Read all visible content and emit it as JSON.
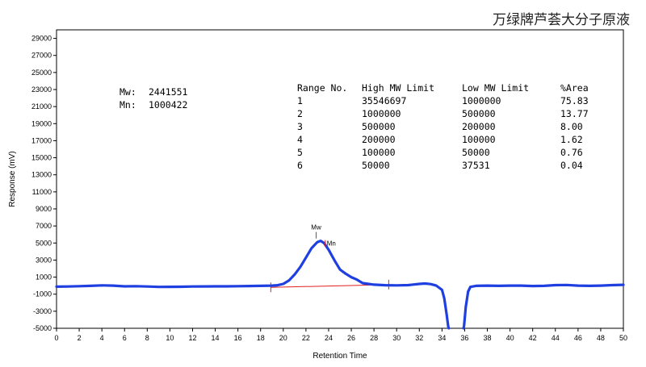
{
  "sample_title": "万绿牌芦荟大分子原液",
  "chart_data": {
    "type": "line",
    "title": "万绿牌芦荟大分子原液",
    "xlabel": "Retention Time",
    "ylabel": "Response (mV)",
    "xlim": [
      0,
      50
    ],
    "ylim": [
      -5000,
      30000
    ],
    "x_ticks": [
      0,
      2,
      4,
      6,
      8,
      10,
      12,
      14,
      16,
      18,
      20,
      22,
      24,
      26,
      28,
      30,
      32,
      34,
      36,
      38,
      40,
      42,
      44,
      46,
      48,
      50
    ],
    "y_ticks": [
      -5000,
      -3000,
      -1000,
      1000,
      3000,
      5000,
      7000,
      9000,
      11000,
      13000,
      15000,
      17000,
      19000,
      21000,
      23000,
      25000,
      27000,
      29000
    ],
    "grid": false,
    "series": [
      {
        "color": "#1f3fe0",
        "x": [
          0,
          1,
          2,
          3,
          4,
          5,
          6,
          7,
          8,
          9,
          10,
          11,
          12,
          13,
          14,
          15,
          16,
          17,
          18,
          19,
          19.5,
          20,
          20.5,
          21,
          21.5,
          22,
          22.5,
          23,
          23.3,
          23.6,
          24,
          24.5,
          25,
          25.5,
          26,
          26.5,
          27,
          28,
          29,
          30,
          31,
          32,
          32.5,
          33,
          33.5,
          34,
          34.2,
          34.4,
          34.55,
          34.6,
          35.9,
          35.95,
          36.1,
          36.3,
          36.5,
          37,
          38,
          39,
          40,
          41,
          42,
          43,
          44,
          45,
          46,
          47,
          48,
          49,
          50
        ],
        "y": [
          -120,
          -100,
          -60,
          -20,
          30,
          0,
          -80,
          -60,
          -100,
          -150,
          -140,
          -130,
          -100,
          -90,
          -80,
          -80,
          -60,
          -40,
          -20,
          0,
          50,
          200,
          600,
          1300,
          2200,
          3300,
          4400,
          5100,
          5250,
          5000,
          4200,
          3000,
          1900,
          1400,
          1000,
          700,
          300,
          120,
          50,
          30,
          60,
          200,
          250,
          180,
          0,
          -500,
          -1500,
          -3300,
          -4800,
          -5000,
          -5000,
          -4700,
          -2500,
          -700,
          -150,
          -20,
          0,
          -20,
          0,
          0,
          -40,
          -20,
          60,
          80,
          0,
          -20,
          0,
          60,
          100
        ]
      },
      {
        "name": "Baseline",
        "color": "#e02020",
        "x": [
          18.9,
          29.3
        ],
        "y": [
          -200,
          120
        ]
      }
    ],
    "annotations": [
      {
        "label": "Mw",
        "x": 22.9,
        "y": 5250
      },
      {
        "label": "Mn",
        "x": 23.7,
        "y": 4300
      }
    ],
    "stats": {
      "mw_label": "Mw:",
      "mw_value": "2441551",
      "mn_label": "Mn:",
      "mn_value": "1000422"
    },
    "table": {
      "columns": [
        "Range No.",
        "High MW Limit",
        "Low MW Limit",
        "%Area"
      ],
      "rows": [
        [
          "1",
          "35546697",
          "1000000",
          "75.83"
        ],
        [
          "2",
          "1000000",
          "500000",
          "13.77"
        ],
        [
          "3",
          "500000",
          "200000",
          "8.00"
        ],
        [
          "4",
          "200000",
          "100000",
          "1.62"
        ],
        [
          "5",
          "100000",
          "50000",
          "0.76"
        ],
        [
          "6",
          "50000",
          "37531",
          "0.04"
        ]
      ]
    }
  }
}
